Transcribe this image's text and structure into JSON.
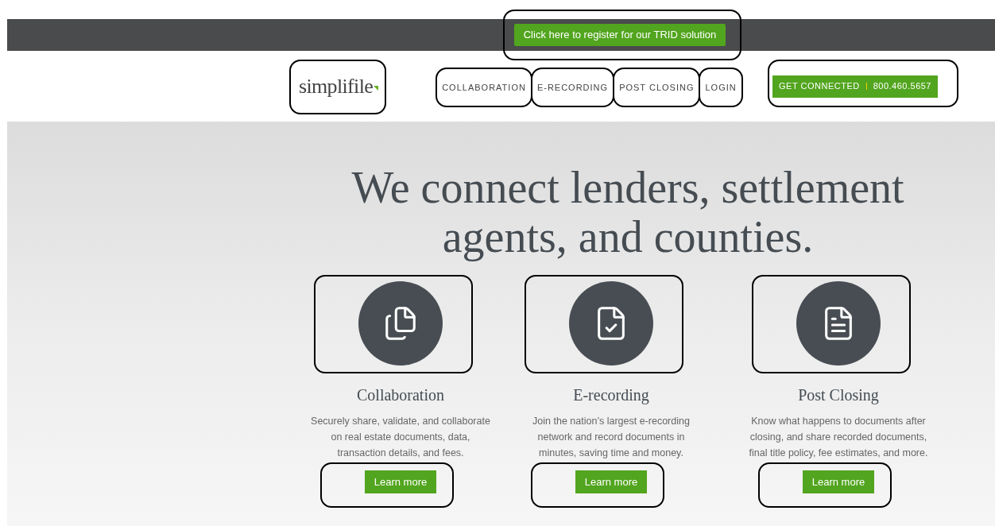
{
  "promo_bar": {
    "button": "Click here to register for our TRID solution"
  },
  "header": {
    "logo": "simplifile",
    "nav": [
      "COLLABORATION",
      "E-RECORDING",
      "POST CLOSING",
      "LOGIN"
    ],
    "cta": {
      "label": "GET CONNECTED",
      "phone": "800.460.5657"
    }
  },
  "hero": {
    "heading_lines": [
      "We connect lenders, settlement",
      "agents, and counties."
    ],
    "features": [
      {
        "kind": "documents",
        "title": "Collaboration",
        "description": "Securely share, validate, and collaborate on real estate documents, data, transaction details, and fees.",
        "button": "Learn more"
      },
      {
        "kind": "recorded",
        "title": "E-recording",
        "description": "Join the nation’s largest e-recording network and record documents in minutes, saving time and money.",
        "button": "Learn more"
      },
      {
        "kind": "list",
        "title": "Post Closing",
        "description": "Know what happens to documents after closing, and share recorded documents, final title policy, fee estimates, and more.",
        "button": "Learn more"
      }
    ]
  }
}
